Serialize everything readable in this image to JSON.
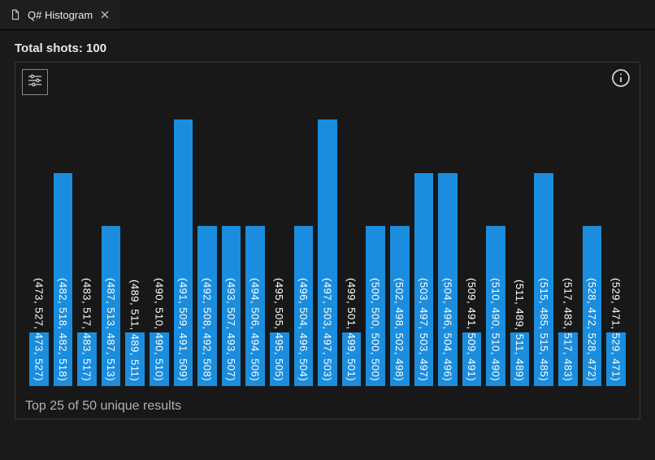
{
  "tab": {
    "title": "Q# Histogram"
  },
  "summary": {
    "total_shots_label": "Total shots: 100"
  },
  "footer": {
    "text": "Top 25 of 50 unique results"
  },
  "chart_data": {
    "type": "bar",
    "title": "Q# Histogram",
    "xlabel": "",
    "ylabel": "",
    "ylim": [
      0,
      5
    ],
    "categories": [
      "(473, 527, 473, 527)",
      "(482, 518, 482, 518)",
      "(483, 517, 483, 517)",
      "(487, 513, 487, 513)",
      "(489, 511, 489, 511)",
      "(490, 510, 490, 510)",
      "(491, 509, 491, 509)",
      "(492, 508, 492, 508)",
      "(493, 507, 493, 507)",
      "(494, 506, 494, 506)",
      "(495, 505, 495, 505)",
      "(496, 504, 496, 504)",
      "(497, 503, 497, 503)",
      "(499, 501, 499, 501)",
      "(500, 500, 500, 500)",
      "(502, 498, 502, 498)",
      "(503, 497, 503, 497)",
      "(504, 496, 504, 496)",
      "(509, 491, 509, 491)",
      "(510, 490, 510, 490)",
      "(511, 489, 511, 489)",
      "(515, 485, 515, 485)",
      "(517, 483, 517, 483)",
      "(528, 472, 528, 472)",
      "(529, 471, 529, 471)"
    ],
    "values": [
      1,
      4,
      1,
      3,
      1,
      1,
      5,
      3,
      3,
      3,
      1,
      3,
      5,
      1,
      3,
      3,
      4,
      4,
      1,
      3,
      1,
      4,
      1,
      3,
      1
    ]
  }
}
